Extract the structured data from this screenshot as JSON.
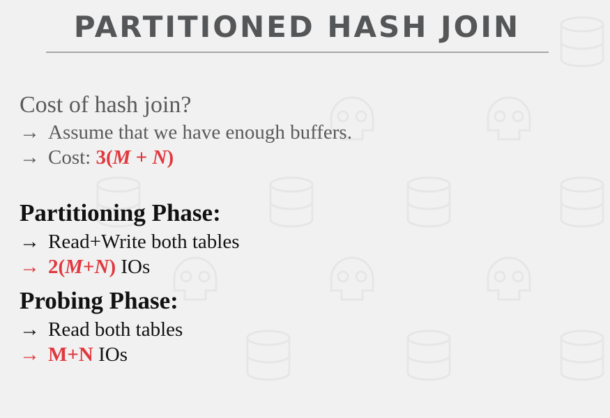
{
  "slide": {
    "title": "PARTITIONED HASH JOIN",
    "question": "Cost of hash join?",
    "arrow": "→",
    "cost_lines": [
      {
        "text": "Assume that we have enough buffers."
      },
      {
        "prefix": "Cost: ",
        "formula_a": "3(",
        "formula_b": "M",
        "formula_c": " + ",
        "formula_d": "N",
        "formula_e": ")"
      }
    ],
    "partition": {
      "heading": "Partitioning Phase:",
      "line1": "Read+Write both tables",
      "line2_a": "2(",
      "line2_b": "M",
      "line2_c": "+",
      "line2_d": "N",
      "line2_e": ")",
      "line2_suffix": " IOs"
    },
    "probe": {
      "heading": "Probing Phase:",
      "line1": "Read both tables",
      "line2_bold": "M+N",
      "line2_suffix": " IOs"
    }
  },
  "colors": {
    "accent": "#e0383e",
    "title": "#555658",
    "background": "#f1f1f1"
  }
}
